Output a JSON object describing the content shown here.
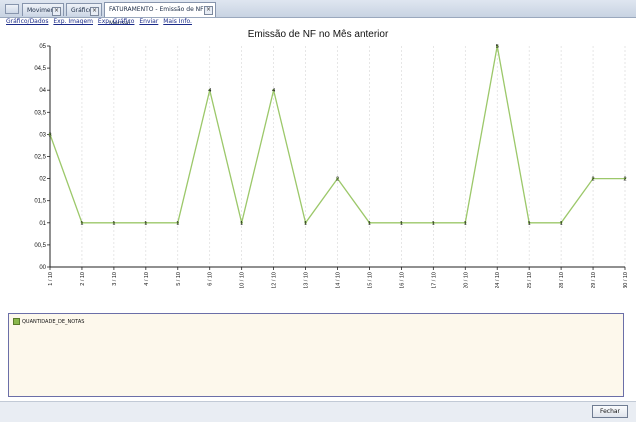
{
  "tabs": [
    {
      "label": "Movimento"
    },
    {
      "label": "Gráfico"
    },
    {
      "label": "FATURAMENTO - Emissão de NF Mensal"
    }
  ],
  "menu": [
    "Gráfico/Dados",
    "Exp. Imagem",
    "Exp. Gráfico",
    "Enviar",
    "Mais Info."
  ],
  "legend": {
    "label": "QUANTIDADE_DE_NOTAS",
    "color": "#8ab84b"
  },
  "footer": {
    "close_label": "Fechar"
  },
  "chart_data": {
    "type": "line",
    "title": "Emissão de NF no Mês anterior",
    "categories": [
      "1 / 10",
      "2 / 10",
      "3 / 10",
      "4 / 10",
      "5 / 10",
      "6 / 10",
      "10 / 10",
      "12 / 10",
      "13 / 10",
      "14 / 10",
      "15 / 10",
      "16 / 10",
      "17 / 10",
      "20 / 10",
      "24 / 10",
      "25 / 10",
      "28 / 10",
      "29 / 10",
      "30 / 10"
    ],
    "series": [
      {
        "name": "QUANTIDADE_DE_NOTAS",
        "values": [
          3,
          1,
          1,
          1,
          1,
          4,
          1,
          4,
          1,
          2,
          1,
          1,
          1,
          1,
          5,
          1,
          1,
          2,
          2
        ]
      }
    ],
    "point_labels": [
      "3",
      "1",
      "1",
      "1",
      "1",
      "4",
      "1",
      "4",
      "1",
      "2",
      "1",
      "1",
      "1",
      "1",
      "5",
      "1",
      "1",
      "2",
      "2"
    ],
    "yticks": [
      "05",
      "04,5",
      "04",
      "03,5",
      "03",
      "02,5",
      "02",
      "01,5",
      "01",
      "00,5",
      "00"
    ],
    "ylim": [
      0,
      5
    ],
    "grid": "vertical"
  }
}
